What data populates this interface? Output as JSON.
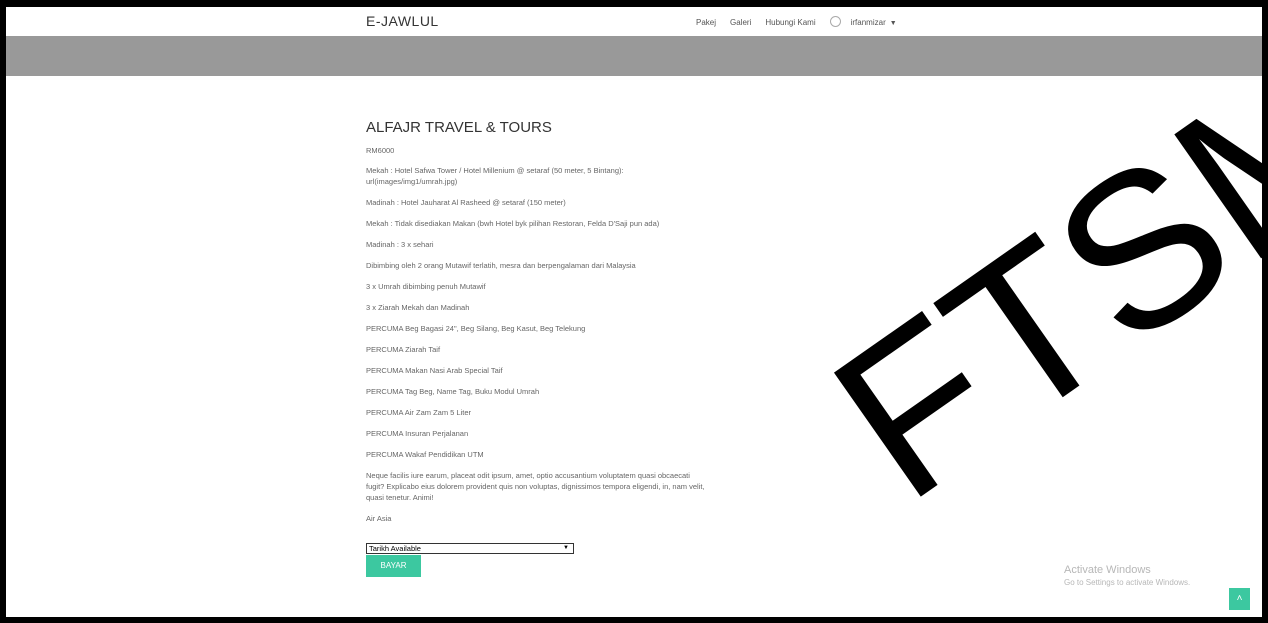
{
  "navbar": {
    "brand": "E-JAWLUL",
    "links": [
      "Pakej",
      "Galeri",
      "Hubungi Kami"
    ],
    "user": "irfanmizar"
  },
  "package": {
    "title": "ALFAJR TRAVEL & TOURS",
    "price": "RM6000",
    "details": [
      "Mekah : Hotel Safwa Tower / Hotel Millenium @ setaraf (50 meter, 5 Bintang): url(images/img1/umrah.jpg)",
      "Madinah : Hotel Jauharat Al Rasheed @ setaraf (150 meter)",
      "Mekah : Tidak disediakan Makan (bwh Hotel byk pilihan Restoran, Felda D'Saji pun ada)",
      "Madinah : 3 x sehari",
      "Dibimbing oleh 2 orang Mutawif terlatih, mesra dan berpengalaman dari Malaysia",
      "3 x Umrah dibimbing penuh Mutawif",
      "3 x Ziarah Mekah dan Madinah",
      "PERCUMA Beg Bagasi 24\", Beg Silang, Beg Kasut, Beg Telekung",
      "PERCUMA Ziarah Taif",
      "PERCUMA Makan Nasi Arab Special Taif",
      "PERCUMA Tag Beg, Name Tag, Buku Modul Umrah",
      "PERCUMA Air Zam Zam 5 Liter",
      "PERCUMA Insuran Perjalanan",
      "PERCUMA Wakaf Pendidikan UTM"
    ],
    "description": "Neque facilis iure earum, placeat odit ipsum, amet, optio accusantium voluptatem quasi obcaecati fugit? Explicabo eius dolorem provident quis non voluptas, dignissimos tempora eligendi, in, nam velit, quasi tenetur. Animi!",
    "airline": "Air Asia",
    "date_select": "Tarikh Available",
    "pay_button": "BAYAR"
  },
  "activate": {
    "line1": "Activate Windows",
    "line2": "Go to Settings to activate Windows."
  },
  "scroll_top_icon": "chevron-up-icon",
  "watermark": "FTSM",
  "colors": {
    "accent": "#3cc8a0",
    "banner": "#999999"
  }
}
